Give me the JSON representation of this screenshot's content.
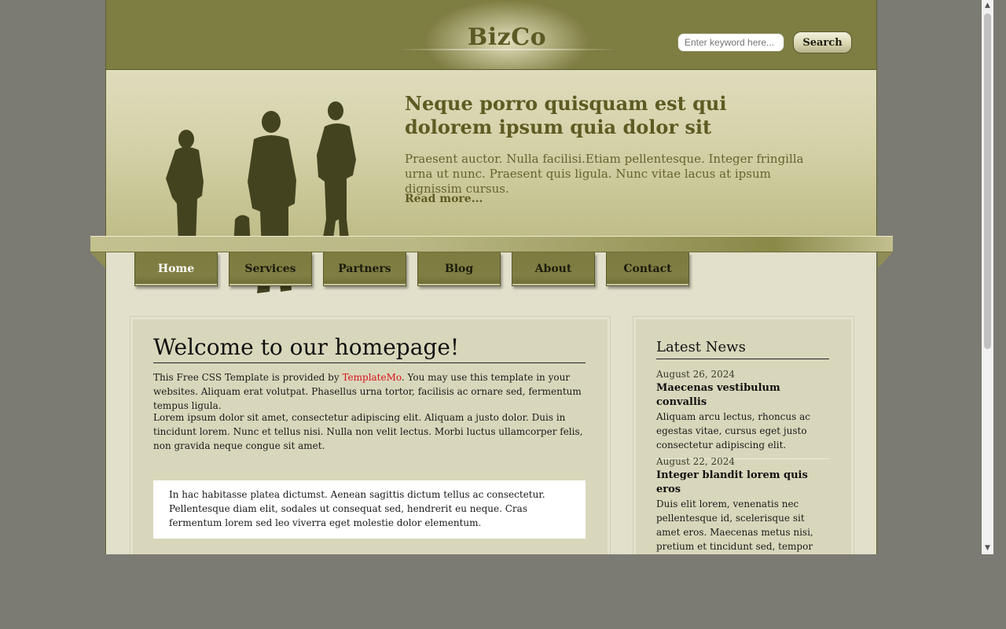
{
  "header": {
    "logo": "BizCo",
    "search": {
      "placeholder": "Enter keyword here...",
      "button_label": "Search"
    }
  },
  "banner": {
    "title": "Neque porro quisquam est qui dolorem ipsum quia dolor sit",
    "text": "Praesent auctor. Nulla facilisi.Etiam pellentesque. Integer fringilla urna ut nunc. Praesent quis ligula. Nunc vitae lacus at ipsum dignissim cursus.",
    "read_more": "Read more..."
  },
  "nav": {
    "items": [
      {
        "label": "Home",
        "active": true
      },
      {
        "label": "Services"
      },
      {
        "label": "Partners"
      },
      {
        "label": "Blog"
      },
      {
        "label": "About"
      },
      {
        "label": "Contact"
      }
    ]
  },
  "main": {
    "title": "Welcome to our homepage!",
    "para1_prefix": "This Free CSS Template is provided by ",
    "para1_link": "TemplateMo",
    "para1_suffix": ". You may use this template in your websites. Aliquam erat volutpat. Phasellus urna tortor, facilisis ac ornare sed, fermentum tempus ligula.",
    "para2": "Lorem ipsum dolor sit amet, consectetur adipiscing elit. Aliquam a justo dolor. Duis in tincidunt lorem. Nunc et tellus nisi. Nulla non velit lectus. Morbi luctus ullamcorper felis, non gravida neque congue sit amet.",
    "quote": "In hac habitasse platea dictumst. Aenean sagittis dictum tellus ac consectetur. Pellentesque diam elit, sodales ut consequat sed, hendrerit eu neque. Cras fermentum lorem sed leo viverra eget molestie dolor elementum."
  },
  "sidebar": {
    "title": "Latest News",
    "news": [
      {
        "date": "August 26, 2024",
        "headline": "Maecenas vestibulum convallis",
        "text": "Aliquam arcu lectus, rhoncus ac egestas vitae, cursus eget justo consectetur adipiscing elit."
      },
      {
        "date": "August 22, 2024",
        "headline": "Integer blandit lorem quis eros",
        "text": "Duis elit lorem, venenatis nec pellentesque id, scelerisque sit amet eros. Maecenas metus nisi, pretium et tincidunt sed, tempor non elit."
      }
    ]
  },
  "colors": {
    "header_olive": "#7e7d42",
    "banner_light": "#dedcbc",
    "link_red": "#d8121b",
    "page_bg": "#e2e0cb",
    "outer_bg": "#7b7a73"
  },
  "icons": {
    "scroll_up": "scroll-up-arrow-icon",
    "scroll_down": "scroll-down-arrow-icon"
  }
}
